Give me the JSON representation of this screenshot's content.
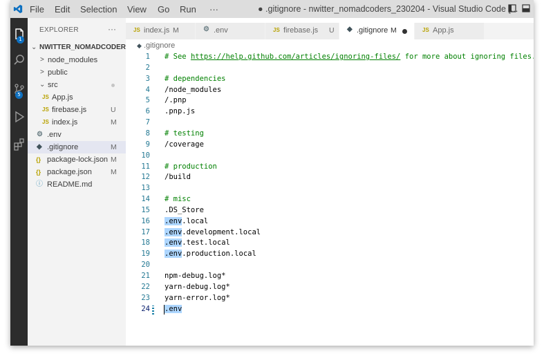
{
  "titlebar": {
    "menus": [
      "File",
      "Edit",
      "Selection",
      "View",
      "Go",
      "Run",
      "···"
    ],
    "window_title": "● .gitignore - nwitter_nomadcoders_230204 - Visual Studio Code [..."
  },
  "activity": {
    "explorer_badge": "1",
    "scm_badge": "5"
  },
  "sidebar": {
    "title": "EXPLORER",
    "more": "···",
    "root_folder": "NWITTER_NOMADCODERS...",
    "items": [
      {
        "label": "node_modules",
        "kind": "folder",
        "status": ""
      },
      {
        "label": "public",
        "kind": "folder",
        "status": ""
      },
      {
        "label": "src",
        "kind": "folder-open",
        "status": "●"
      },
      {
        "label": "App.js",
        "kind": "js",
        "status": ""
      },
      {
        "label": "firebase.js",
        "kind": "js",
        "status": "U"
      },
      {
        "label": "index.js",
        "kind": "js",
        "status": "M"
      },
      {
        "label": ".env",
        "kind": "gear",
        "status": ""
      },
      {
        "label": ".gitignore",
        "kind": "diamond",
        "status": "M"
      },
      {
        "label": "package-lock.json",
        "kind": "json",
        "status": "M"
      },
      {
        "label": "package.json",
        "kind": "json",
        "status": "M"
      },
      {
        "label": "README.md",
        "kind": "info",
        "status": ""
      }
    ]
  },
  "tabs": [
    {
      "icon": "JS",
      "name": "index.js",
      "status": "M"
    },
    {
      "icon": "gear",
      "name": ".env",
      "status": ""
    },
    {
      "icon": "JS",
      "name": "firebase.js",
      "status": "U"
    },
    {
      "icon": "diamond",
      "name": ".gitignore",
      "status": "M"
    },
    {
      "icon": "JS",
      "name": "App.js",
      "status": ""
    }
  ],
  "editor": {
    "breadcrumb": ".gitignore",
    "lines": [
      "# See https://help.github.com/articles/ignoring-files/ for more about ignoring files.",
      "",
      "# dependencies",
      "/node_modules",
      "/.pnp",
      ".pnp.js",
      "",
      "# testing",
      "/coverage",
      "",
      "# production",
      "/build",
      "",
      "# misc",
      ".DS_Store",
      ".env.local",
      ".env.development.local",
      ".env.test.local",
      ".env.production.local",
      "",
      "npm-debug.log*",
      "yarn-debug.log*",
      "yarn-error.log*",
      ".env"
    ],
    "comment_prefix": "# See ",
    "url": "https://help.github.com/articles/ignoring-files/",
    "comment_suffix": " for more about ignoring files.",
    "current_line": 24
  },
  "colors": {
    "accent": "#0e70c0",
    "comment": "#008000",
    "line_number": "#237893",
    "highlight": "#add6ff"
  }
}
